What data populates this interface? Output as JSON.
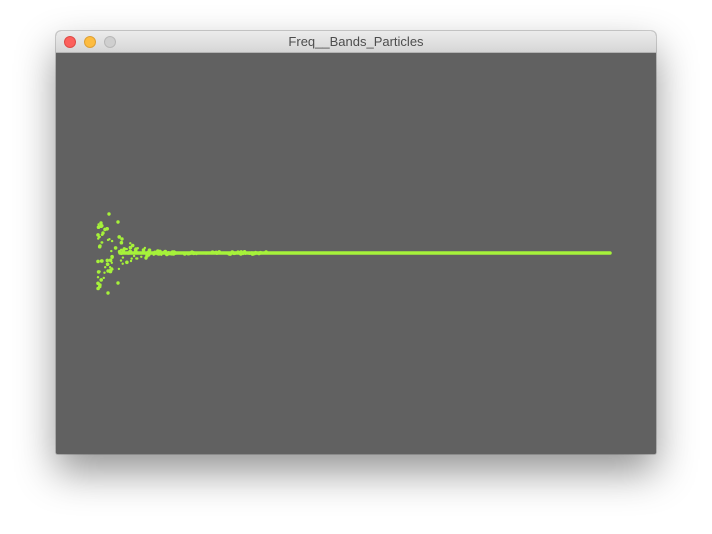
{
  "window": {
    "title": "Freq__Bands_Particles"
  },
  "colors": {
    "canvas_background": "#616161",
    "particle": "#a6f23a",
    "close": "#fc605c",
    "minimize": "#fdbc40",
    "zoom": "#cfcfcf"
  },
  "icons": {
    "close": "close-icon",
    "minimize": "minimize-icon",
    "zoom": "zoom-icon"
  }
}
